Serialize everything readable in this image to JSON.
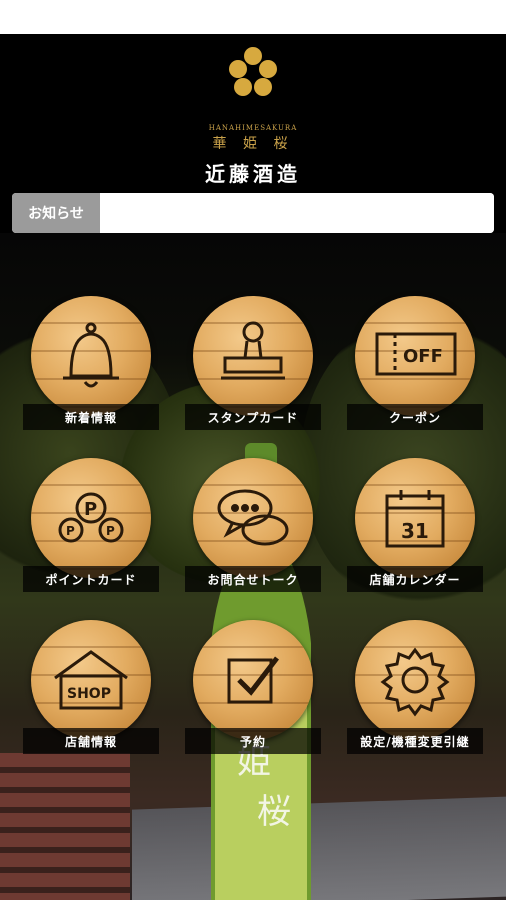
{
  "brand": {
    "romaji": "HANAHIMESAKURA",
    "name_kanji": "華 姫 桜",
    "company": "近藤酒造"
  },
  "news": {
    "label": "お知らせ",
    "content": ""
  },
  "menu": [
    {
      "label": "新着情報",
      "icon": "bell-icon"
    },
    {
      "label": "スタンプカード",
      "icon": "stamp-icon"
    },
    {
      "label": "クーポン",
      "icon": "coupon-icon",
      "icon_text": "OFF"
    },
    {
      "label": "ポイントカード",
      "icon": "points-icon",
      "icon_text": "P"
    },
    {
      "label": "お問合せトーク",
      "icon": "chat-icon"
    },
    {
      "label": "店舗カレンダー",
      "icon": "calendar-icon",
      "icon_text": "31"
    },
    {
      "label": "店舗情報",
      "icon": "shop-icon",
      "icon_text": "SHOP"
    },
    {
      "label": "予約",
      "icon": "checkbox-icon"
    },
    {
      "label": "設定/機種変更引継",
      "icon": "gear-icon"
    }
  ],
  "colors": {
    "gold": "#caa24a",
    "wood": "#e2ab60",
    "label_bg": "#000000",
    "news_label_bg": "#9b9b9b"
  }
}
